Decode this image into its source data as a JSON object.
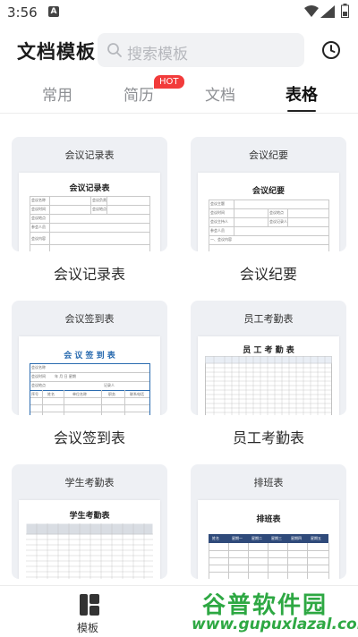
{
  "status_bar": {
    "time": "3:56",
    "app_badge": "A"
  },
  "header": {
    "title": "文档模板",
    "search_placeholder": "搜索模板"
  },
  "tabs": [
    {
      "label": "常用",
      "active": false
    },
    {
      "label": "简历",
      "active": false,
      "badge": "HOT"
    },
    {
      "label": "文档",
      "active": false
    },
    {
      "label": "表格",
      "active": true
    }
  ],
  "cards": [
    {
      "thumb_title": "会议记录表",
      "sheet_title": "会议记录表",
      "label": "会议记录表",
      "fields": [
        "会议名称",
        "会议时间",
        "会议地点",
        "参会人员",
        "会议内容",
        "会议负责",
        "会议地点"
      ]
    },
    {
      "thumb_title": "会议纪要",
      "sheet_title": "会议纪要",
      "label": "会议纪要",
      "fields": [
        "会议主题",
        "会议时间",
        "会议主持人",
        "参会人员",
        "会议地点",
        "会议记录人",
        "一、会议内容"
      ]
    },
    {
      "thumb_title": "会议签到表",
      "sheet_title": "会 议 签 到 表",
      "label": "会议签到表",
      "fields": [
        "会议名称",
        "会议时间",
        "年 月 日 星期",
        "会议地点",
        "记录人",
        "序号",
        "姓名",
        "单位名称",
        "职务",
        "联系电话"
      ]
    },
    {
      "thumb_title": "员工考勤表",
      "sheet_title": "员 工 考 勤 表",
      "label": "员工考勤表",
      "fields": []
    },
    {
      "thumb_title": "学生考勤表",
      "sheet_title": "学生考勤表",
      "label": "学生考勤表",
      "fields": []
    },
    {
      "thumb_title": "排班表",
      "sheet_title": "排班表",
      "label": "排班表",
      "fields": [
        "姓名",
        "星期一",
        "星期二",
        "星期三",
        "星期四",
        "星期五"
      ]
    }
  ],
  "bottom_nav": {
    "label": "模板"
  },
  "watermark": {
    "name": "谷普软件园",
    "url": "www.gupuxlazal.com"
  },
  "colors": {
    "hot_badge": "#f23b3b",
    "watermark": "#2ea843",
    "schedule_header": "#2f4a7a",
    "attendance_blue": "#2b6cb0"
  },
  "icons": [
    "wifi-icon",
    "signal-icon",
    "battery-icon",
    "search-icon",
    "clock-icon",
    "template-icon"
  ]
}
